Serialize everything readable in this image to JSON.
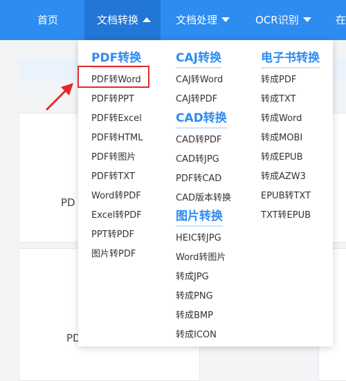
{
  "nav": {
    "home": "首页",
    "doc_convert": "文档转换",
    "doc_process": "文档处理",
    "ocr": "OCR识别",
    "more": "在"
  },
  "background": {
    "card1_label": "PD",
    "card2_label": "PD"
  },
  "menu": {
    "pdf": {
      "heading": "PDF转换",
      "items": [
        "PDF转Word",
        "PDF转PPT",
        "PDF转Excel",
        "PDF转HTML",
        "PDF转图片",
        "PDF转TXT",
        "Word转PDF",
        "Excel转PDF",
        "PPT转PDF",
        "图片转PDF"
      ]
    },
    "caj": {
      "heading": "CAJ转换",
      "items": [
        "CAJ转Word",
        "CAJ转PDF"
      ]
    },
    "cad": {
      "heading": "CAD转换",
      "items": [
        "CAD转PDF",
        "CAD转JPG",
        "PDF转CAD",
        "CAD版本转换"
      ]
    },
    "image": {
      "heading": "图片转换",
      "items": [
        "HEIC转JPG",
        "Word转图片",
        "转成JPG",
        "转成PNG",
        "转成BMP",
        "转成ICON"
      ]
    },
    "ebook": {
      "heading": "电子书转换",
      "items": [
        "转成PDF",
        "转成TXT",
        "转成Word",
        "转成MOBI",
        "转成EPUB",
        "转成AZW3",
        "EPUB转TXT",
        "TXT转EPUB"
      ]
    }
  },
  "colors": {
    "nav_bg": "#2d8cf0",
    "nav_active_bg": "#2176d6",
    "heading": "#2d8cf0",
    "highlight": "#e02a2a"
  }
}
